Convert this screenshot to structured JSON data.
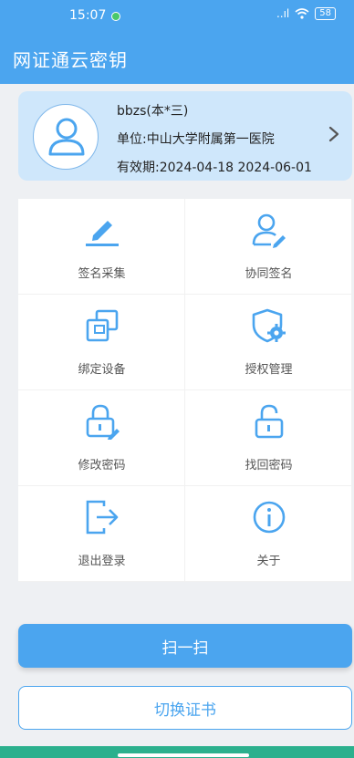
{
  "status_bar": {
    "time": "15:07",
    "signal": "..ıl",
    "battery": "58"
  },
  "header": {
    "title": "网证通云密钥"
  },
  "profile": {
    "name": "bbzs(本*三)",
    "unit": "单位:中山大学附属第一医院",
    "validity": "有效期:2024-04-18 2024-06-01"
  },
  "menu": {
    "items": [
      {
        "label": "签名采集",
        "icon": "pen-icon"
      },
      {
        "label": "协同签名",
        "icon": "user-edit-icon"
      },
      {
        "label": "绑定设备",
        "icon": "devices-icon"
      },
      {
        "label": "授权管理",
        "icon": "shield-gear-icon"
      },
      {
        "label": "修改密码",
        "icon": "lock-edit-icon"
      },
      {
        "label": "找回密码",
        "icon": "unlock-icon"
      },
      {
        "label": "退出登录",
        "icon": "logout-icon"
      },
      {
        "label": "关于",
        "icon": "info-icon"
      }
    ]
  },
  "buttons": {
    "scan": "扫一扫",
    "switch_cert": "切换证书"
  },
  "colors": {
    "primary": "#4ba5ef",
    "card": "#cfe7fb",
    "nav_bar": "#2bb08d"
  }
}
